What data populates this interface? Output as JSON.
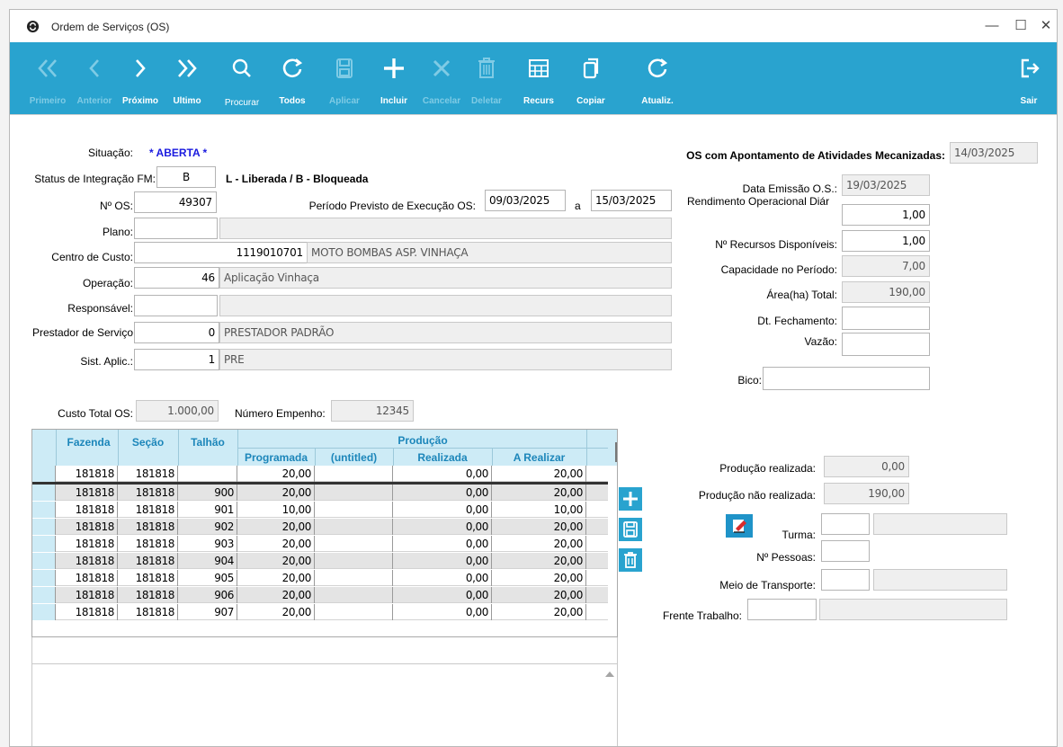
{
  "window": {
    "title": "Ordem de Serviços (OS)",
    "controls": {
      "minimize": "—",
      "maximize": "☐",
      "close": "✕"
    }
  },
  "toolbar": {
    "primeiro": "Primeiro",
    "anterior": "Anterior",
    "proximo": "Próximo",
    "ultimo": "Ultimo",
    "procurar": "Procurar",
    "todos": "Todos",
    "aplicar": "Aplicar",
    "incluir": "Incluir",
    "cancelar": "Cancelar",
    "deletar": "Deletar",
    "recurs": "Recurs",
    "copiar": "Copiar",
    "atualiz": "Atualiz.",
    "sair": "Sair"
  },
  "form": {
    "situacao_label": "Situação:",
    "situacao_value": "* ABERTA *",
    "status_label": "Status de Integração FM:",
    "status_value": "B",
    "status_legend": "L - Liberada / B - Bloqueada",
    "nos_label": "Nº OS:",
    "nos_value": "49307",
    "periodo_label": "Período Previsto de Execução OS:",
    "periodo_inicio": "09/03/2025",
    "periodo_sep": "a",
    "periodo_fim": "15/03/2025",
    "plano_label": "Plano:",
    "plano_value": "",
    "centro_label": "Centro de Custo:",
    "centro_code": "1119010701",
    "centro_desc": "MOTO BOMBAS ASP. VINHAÇA",
    "operacao_label": "Operação:",
    "operacao_code": "46",
    "operacao_desc": "Aplicação Vinhaça",
    "responsavel_label": "Responsável:",
    "responsavel_value": "",
    "prestador_label": "Prestador de Serviço",
    "prestador_code": "0",
    "prestador_desc": "PRESTADOR PADRÃO",
    "sist_label": "Sist. Aplic.:",
    "sist_code": "1",
    "sist_desc": "PRE",
    "custo_label": "Custo Total OS:",
    "custo_value": "1.000,00",
    "empenho_label": "Número Empenho:",
    "empenho_value": "12345"
  },
  "right": {
    "apontamento_label": "OS com Apontamento de Atividades Mecanizadas:",
    "apontamento_value": "14/03/2025",
    "emissao_label": "Data Emissão O.S.:",
    "emissao_value": "19/03/2025",
    "rendimento_label": "Rendimento Operacional Diár",
    "rendimento_value": "1,00",
    "recursos_label": "Nº Recursos Disponíveis:",
    "recursos_value": "1,00",
    "capacidade_label": "Capacidade no Período:",
    "capacidade_value": "7,00",
    "area_label": "Área(ha) Total:",
    "area_value": "190,00",
    "fechamento_label": "Dt. Fechamento:",
    "fechamento_value": "",
    "vazao_label": "Vazão:",
    "vazao_value": "",
    "bico_label": "Bico:",
    "bico_value": "",
    "prod_realizada_label": "Produção realizada:",
    "prod_realizada_value": "0,00",
    "prod_nao_label": "Produção não realizada:",
    "prod_nao_value": "190,00",
    "turma_label": "Turma:",
    "pessoas_label": "Nº Pessoas:",
    "transporte_label": "Meio de Transporte:",
    "frente_label": "Frente Trabalho:"
  },
  "grid": {
    "headers": {
      "fazenda": "Fazenda",
      "secao": "Seção",
      "talhao": "Talhão",
      "producao": "Produção",
      "programada": "Programada",
      "untitled": "(untitled)",
      "realizada": "Realizada",
      "a_realizar": "A Realizar"
    },
    "rows": [
      {
        "fazenda": "181818",
        "secao": "181818",
        "talhao": "",
        "programada": "20,00",
        "untitled": "",
        "realizada": "0,00",
        "a_realizar": "20,00"
      },
      {
        "fazenda": "181818",
        "secao": "181818",
        "talhao": "900",
        "programada": "20,00",
        "untitled": "",
        "realizada": "0,00",
        "a_realizar": "20,00"
      },
      {
        "fazenda": "181818",
        "secao": "181818",
        "talhao": "901",
        "programada": "10,00",
        "untitled": "",
        "realizada": "0,00",
        "a_realizar": "10,00"
      },
      {
        "fazenda": "181818",
        "secao": "181818",
        "talhao": "902",
        "programada": "20,00",
        "untitled": "",
        "realizada": "0,00",
        "a_realizar": "20,00"
      },
      {
        "fazenda": "181818",
        "secao": "181818",
        "talhao": "903",
        "programada": "20,00",
        "untitled": "",
        "realizada": "0,00",
        "a_realizar": "20,00"
      },
      {
        "fazenda": "181818",
        "secao": "181818",
        "talhao": "904",
        "programada": "20,00",
        "untitled": "",
        "realizada": "0,00",
        "a_realizar": "20,00"
      },
      {
        "fazenda": "181818",
        "secao": "181818",
        "talhao": "905",
        "programada": "20,00",
        "untitled": "",
        "realizada": "0,00",
        "a_realizar": "20,00"
      },
      {
        "fazenda": "181818",
        "secao": "181818",
        "talhao": "906",
        "programada": "20,00",
        "untitled": "",
        "realizada": "0,00",
        "a_realizar": "20,00"
      },
      {
        "fazenda": "181818",
        "secao": "181818",
        "talhao": "907",
        "programada": "20,00",
        "untitled": "",
        "realizada": "0,00",
        "a_realizar": "20,00"
      }
    ]
  },
  "icons": {
    "accent": "#29a3cf",
    "window": "circle-logo-icon",
    "primeiro": "double-chevron-left-icon",
    "anterior": "chevron-left-icon",
    "proximo": "chevron-right-icon",
    "ultimo": "double-chevron-right-icon",
    "procurar": "search-icon",
    "todos": "refresh-icon",
    "aplicar": "save-icon",
    "incluir": "plus-icon",
    "cancelar": "x-icon",
    "deletar": "trash-icon",
    "recurs": "grid-icon",
    "copiar": "copy-icon",
    "atualiz": "refresh-icon",
    "sair": "exit-icon"
  }
}
